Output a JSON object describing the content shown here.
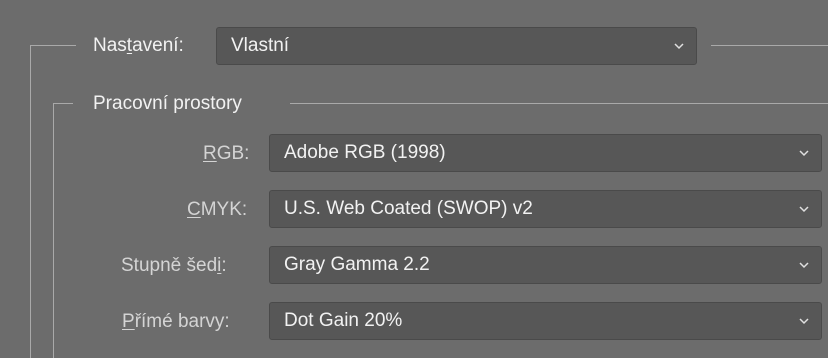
{
  "settings": {
    "label_pre": "Nas",
    "label_accel": "t",
    "label_post": "avení:",
    "value": "Vlastní"
  },
  "working_spaces": {
    "title": "Pracovní prostory",
    "rgb": {
      "label_accel": "R",
      "label_post": "GB:",
      "value": "Adobe RGB (1998)"
    },
    "cmyk": {
      "label_accel": "C",
      "label_post": "MYK:",
      "value": "U.S. Web Coated (SWOP) v2"
    },
    "gray": {
      "label_pre": "Stupně šed",
      "label_accel": "i",
      "label_post": ":",
      "value": "Gray Gamma 2.2"
    },
    "spot": {
      "label_accel": "P",
      "label_post": "římé barvy:",
      "value": "Dot Gain 20%"
    }
  },
  "icons": {
    "dropdown": "chevron-down-icon"
  },
  "colors": {
    "background": "#6c6c6c",
    "field": "#575757",
    "text": "#f2f2f2",
    "frame": "#a9a9a9"
  }
}
